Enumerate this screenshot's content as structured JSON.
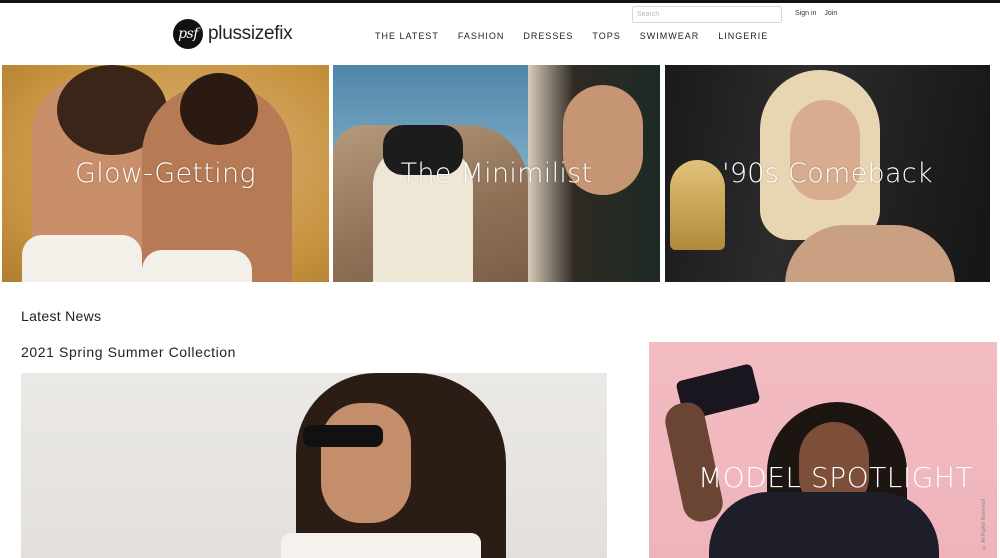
{
  "header": {
    "logo_mark": "psf",
    "logo_text": "plussizefix",
    "search_placeholder": "Search",
    "sign_in": "Sign in",
    "join": "Join"
  },
  "nav": {
    "items": [
      {
        "label": "THE LATEST"
      },
      {
        "label": "FASHION"
      },
      {
        "label": "DRESSES"
      },
      {
        "label": "TOPS"
      },
      {
        "label": "SWIMWEAR"
      },
      {
        "label": "LINGERIE"
      }
    ]
  },
  "tiles": [
    {
      "label": "Glow-Getting"
    },
    {
      "label": "The Minimilist"
    },
    {
      "label": "'90s Comeback"
    }
  ],
  "news": {
    "section_title": "Latest News",
    "article_title": "2021 Spring Summer Collection"
  },
  "spotlight": {
    "label": "MODEL SPOTLIGHT",
    "credit": "© All Rights Reserved"
  },
  "colors": {
    "tile1_bg": "#d4a45f",
    "spotlight_bg": "#f3bcc2",
    "text": "#222222"
  }
}
